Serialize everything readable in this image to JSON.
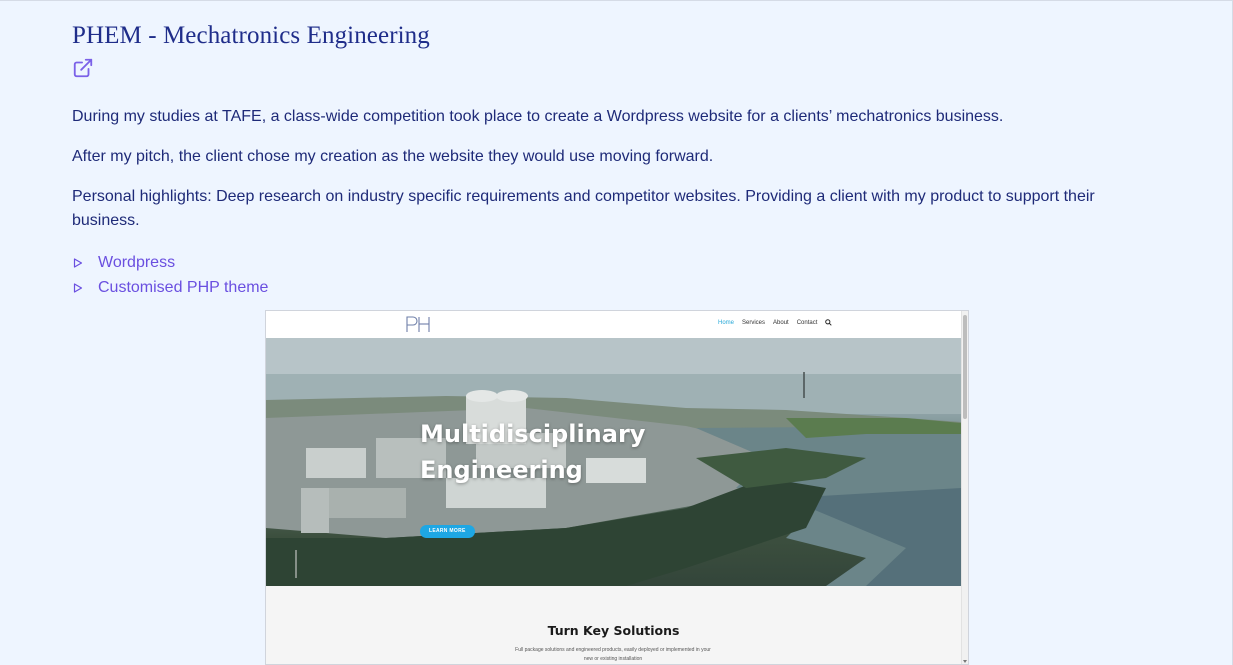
{
  "project": {
    "title": "PHEM - Mechatronics Engineering",
    "external_link_icon": "external-link-icon",
    "paragraphs": [
      "During my studies at TAFE, a class-wide competition took place to create a Wordpress website for a clients’ mechatronics business.",
      "After my pitch, the client chose my creation as the website they would use moving forward.",
      "Personal highlights: Deep research on industry specific requirements and competitor websites. Providing a client with my product to support their business."
    ],
    "tech": [
      {
        "label": "Wordpress",
        "icon": "triangle-right-icon"
      },
      {
        "label": "Customised PHP theme",
        "icon": "triangle-right-icon"
      }
    ]
  },
  "screenshot": {
    "logo_text": "PH",
    "nav": [
      "Home",
      "Services",
      "About",
      "Contact"
    ],
    "nav_active": "Home",
    "search_icon": "search-icon",
    "hero_title": "Multidisciplinary Engineering",
    "hero_button": "LEARN MORE",
    "section_title": "Turn Key Solutions",
    "section_text": "Full package solutions and engineered products, easily deployed or implemented in your new or existing installation"
  },
  "colors": {
    "background": "#eef5ff",
    "heading": "#1f2d8a",
    "text": "#1e2a78",
    "link": "#6a4fe0",
    "accent_button": "#1ea7e4"
  }
}
